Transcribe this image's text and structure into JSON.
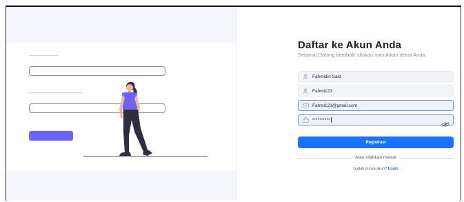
{
  "register": {
    "title": "Daftar ke Akun Anda",
    "subtitle": "Selamat Datang kembali! silakan masukkan detail Anda",
    "fields": {
      "name": {
        "value": "Fahmidin Said",
        "icon": "user-icon"
      },
      "username": {
        "value": "Fahmi123",
        "icon": "user-icon"
      },
      "email": {
        "value": "Fahmi123@gmail.com",
        "icon": "mail-icon"
      },
      "password": {
        "value": "••••••••••",
        "icon": "lock-icon",
        "toggle_icon": "eye-icon"
      }
    },
    "submit_label": "Registrasi",
    "divider_text": "Atau silahkan masuk",
    "signin_prompt": "Sudah punya akun?",
    "signin_link": "Login"
  },
  "colors": {
    "accent": "#1a73ff",
    "illustration_accent": "#6c63ff",
    "text": "#1d1f26"
  }
}
